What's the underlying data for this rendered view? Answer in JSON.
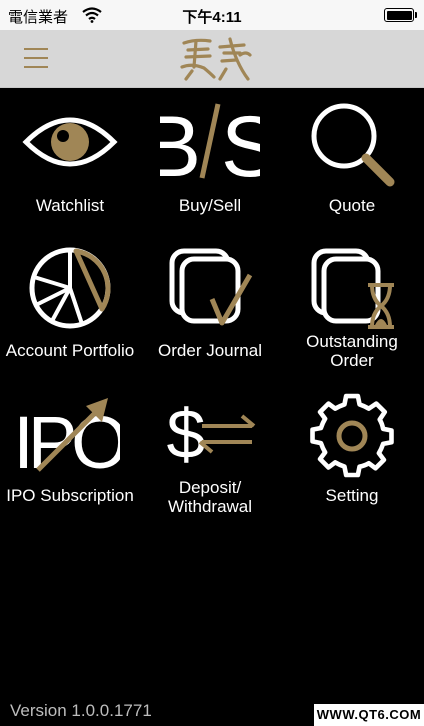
{
  "status_bar": {
    "carrier": "電信業者",
    "time": "下午4:11"
  },
  "colors": {
    "accent": "#a08656",
    "icon_stroke": "#ffffff",
    "background": "#000000",
    "nav_background": "#d7d7d7"
  },
  "menu": [
    {
      "label": "Watchlist",
      "icon": "eye-icon"
    },
    {
      "label": "Buy/Sell",
      "icon": "buy-sell-icon"
    },
    {
      "label": "Quote",
      "icon": "magnifier-icon"
    },
    {
      "label": "Account Portfolio",
      "icon": "pie-chart-icon"
    },
    {
      "label": "Order Journal",
      "icon": "stacked-docs-check-icon"
    },
    {
      "label": "Outstanding Order",
      "icon": "stacked-docs-hourglass-icon"
    },
    {
      "label": "IPO Subscription",
      "icon": "ipo-arrow-icon"
    },
    {
      "label": "Deposit/ Withdrawal",
      "icon": "dollar-transfer-icon"
    },
    {
      "label": "Setting",
      "icon": "gear-icon"
    }
  ],
  "footer": {
    "version": "Version 1.0.0.1771"
  },
  "watermark": "WWW.QT6.COM"
}
